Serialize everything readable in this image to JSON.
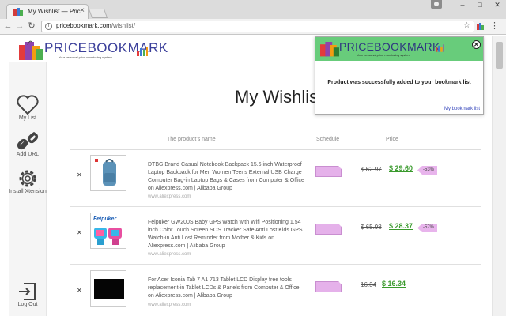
{
  "browser": {
    "tab_title": "My Wishlist — Pricebo",
    "url_domain": "pricebookmark.com",
    "url_path": "/wishlist/"
  },
  "logo": {
    "name": "PRICEBOOKMARK",
    "tagline": "Your personal price monitoring system"
  },
  "sidebar": {
    "items": [
      {
        "label": "My List",
        "icon": "heart-icon"
      },
      {
        "label": "Add URL",
        "icon": "link-icon"
      },
      {
        "label": "Install Xtension",
        "icon": "gear-icon"
      },
      {
        "label": "Log Out",
        "icon": "logout-icon"
      }
    ]
  },
  "page": {
    "title": "My Wishlist"
  },
  "table": {
    "headers": {
      "product": "The product's name",
      "schedule": "Schedule",
      "price": "Price"
    },
    "rows": [
      {
        "description": "DTBG Brand Casual Notebook Backpack 15.6 inch Waterproof Laptop Backpack for Men Women Teens External USB Charge Computer Bag-in Laptop Bags & Cases from Computer & Office on Aliexpress.com | Alibaba Group",
        "site": "www.aliexpress.com",
        "old_price": "$ 62.97",
        "new_price": "$ 29.60",
        "discount": "-53%",
        "image": "backpack"
      },
      {
        "description": "Feipuker GW200S Baby GPS Watch with Wifi Positioning 1.54 inch Color Touch Screen SOS Tracker Safe Anti Lost Kids GPS Watch-in Anti Lost Reminder from Mother & Kids on Aliexpress.com | Alibaba Group",
        "site": "www.aliexpress.com",
        "old_price": "$ 65.98",
        "new_price": "$ 28.37",
        "discount": "-57%",
        "image": "watch",
        "image_brand": "Feipuker"
      },
      {
        "description": "For Acer Iconia Tab 7 A1 713 Tablet LCD Display free tools replacement-in Tablet LCDs & Panels from Computer & Office on Aliexpress.com | Alibaba Group",
        "site": "www.aliexpress.com",
        "old_price": "16.34",
        "new_price": "$ 16.34",
        "discount": "",
        "image": "lcd-panel"
      }
    ]
  },
  "popup": {
    "logo": "PRICEBOOKMARK",
    "tagline": "Your personal price monitoring system",
    "message": "Product was successfully added to your bookmark list",
    "link": "My bookmark list",
    "close": "✕"
  },
  "colors": {
    "brand": "#3b3f9a",
    "popup_header": "#68cc7b",
    "price_green": "#3a9a2d",
    "schedule_pink": "#e5b1ea"
  }
}
